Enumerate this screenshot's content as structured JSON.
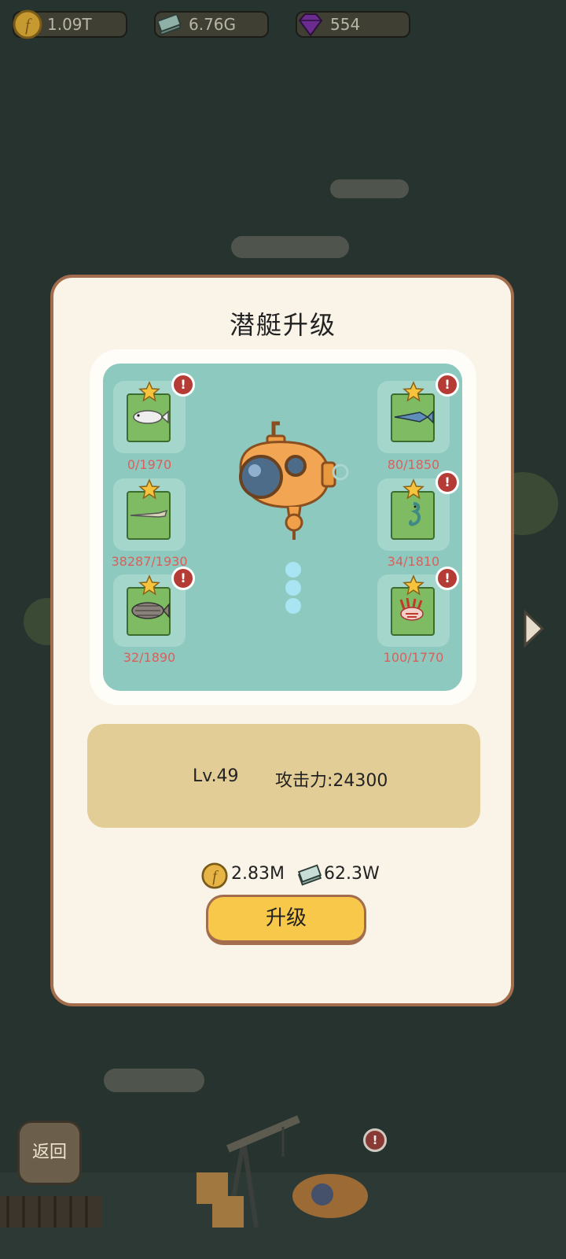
{
  "resources": [
    {
      "icon": "gold-coin-icon",
      "value": "1.09T"
    },
    {
      "icon": "cash-stack-icon",
      "value": "6.76G"
    },
    {
      "icon": "purple-gem-icon",
      "value": "554"
    }
  ],
  "dialog": {
    "title": "潜艇升级",
    "fish_slots": [
      {
        "fish": "white-fish-icon",
        "count": "0/1970",
        "alert": "!"
      },
      {
        "fish": "blue-swordfish-icon",
        "count": "80/1850",
        "alert": "!"
      },
      {
        "fish": "needlefish-icon",
        "count": "38287/1930"
      },
      {
        "fish": "seahorse-icon",
        "count": "34/1810",
        "alert": "!"
      },
      {
        "fish": "grouper-icon",
        "count": "32/1890",
        "alert": "!"
      },
      {
        "fish": "lionfish-icon",
        "count": "100/1770",
        "alert": "!"
      }
    ],
    "level": "Lv.49",
    "attack": "攻击力:24300",
    "cost": {
      "gold": "2.83M",
      "cash": "62.3W"
    },
    "upgrade_label": "升级"
  },
  "back_label": "返回",
  "colors": {
    "background": "#26332f",
    "dialog_bg": "#f9f3e8",
    "dialog_border": "#a36c4c",
    "panel": "#8ec9c0",
    "info_box": "#e2cd97",
    "button": "#f7c84a",
    "count_text": "#d8605a"
  }
}
